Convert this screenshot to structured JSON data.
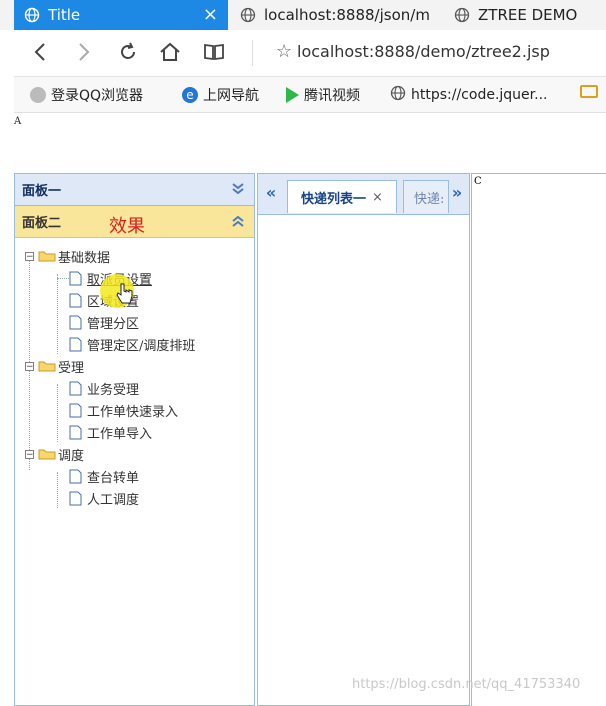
{
  "browser": {
    "tabs": [
      {
        "title": "Title",
        "active": true
      },
      {
        "title": "localhost:8888/json/m"
      },
      {
        "title": "ZTREE DEMO"
      }
    ],
    "url": "localhost:8888/demo/ztree2.jsp",
    "bookmarks": [
      "登录QQ浏览器",
      "上网导航",
      "腾讯视频",
      "https://code.jquer..."
    ]
  },
  "layout": {
    "north_label": "A",
    "east_label": "C"
  },
  "accordion": {
    "panel1_title": "面板一",
    "panel2_title": "面板二",
    "effect_label": "效果"
  },
  "tree": {
    "groups": [
      {
        "label": "基础数据",
        "children": [
          "取派员设置",
          "区域设置",
          "管理分区",
          "管理定区/调度排班"
        ]
      },
      {
        "label": "受理",
        "children": [
          "业务受理",
          "工作单快速录入",
          "工作单导入"
        ]
      },
      {
        "label": "调度",
        "children": [
          "查台转单",
          "人工调度"
        ]
      }
    ]
  },
  "center_tabs": {
    "active": "快递列表一",
    "second": "快递:"
  },
  "watermark": "https://blog.csdn.net/qq_41753340",
  "colors": {
    "accent": "#1e88e5",
    "panel_border": "#99bbe8",
    "accordion_active": "#fae69b",
    "effect": "#e01e1e"
  }
}
